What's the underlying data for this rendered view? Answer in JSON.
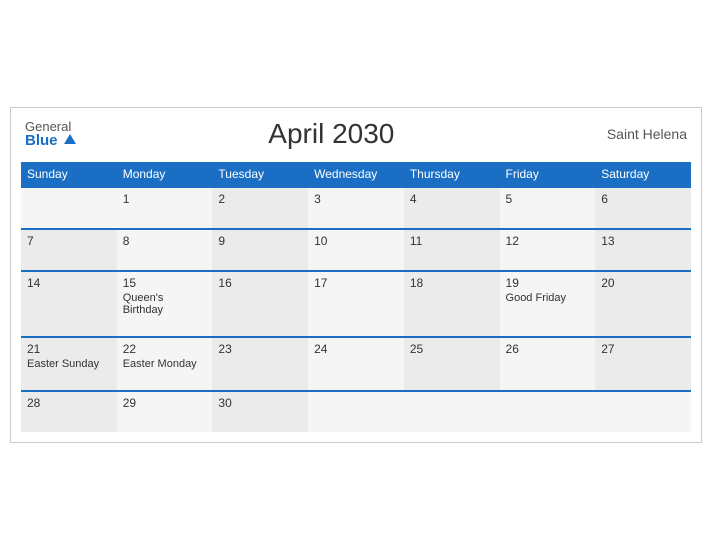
{
  "header": {
    "logo_general": "General",
    "logo_blue": "Blue",
    "title": "April 2030",
    "region": "Saint Helena"
  },
  "days_of_week": [
    "Sunday",
    "Monday",
    "Tuesday",
    "Wednesday",
    "Thursday",
    "Friday",
    "Saturday"
  ],
  "weeks": [
    [
      {
        "day": "",
        "event": ""
      },
      {
        "day": "1",
        "event": ""
      },
      {
        "day": "2",
        "event": ""
      },
      {
        "day": "3",
        "event": ""
      },
      {
        "day": "4",
        "event": ""
      },
      {
        "day": "5",
        "event": ""
      },
      {
        "day": "6",
        "event": ""
      }
    ],
    [
      {
        "day": "7",
        "event": ""
      },
      {
        "day": "8",
        "event": ""
      },
      {
        "day": "9",
        "event": ""
      },
      {
        "day": "10",
        "event": ""
      },
      {
        "day": "11",
        "event": ""
      },
      {
        "day": "12",
        "event": ""
      },
      {
        "day": "13",
        "event": ""
      }
    ],
    [
      {
        "day": "14",
        "event": ""
      },
      {
        "day": "15",
        "event": "Queen's Birthday"
      },
      {
        "day": "16",
        "event": ""
      },
      {
        "day": "17",
        "event": ""
      },
      {
        "day": "18",
        "event": ""
      },
      {
        "day": "19",
        "event": "Good Friday"
      },
      {
        "day": "20",
        "event": ""
      }
    ],
    [
      {
        "day": "21",
        "event": "Easter Sunday"
      },
      {
        "day": "22",
        "event": "Easter Monday"
      },
      {
        "day": "23",
        "event": ""
      },
      {
        "day": "24",
        "event": ""
      },
      {
        "day": "25",
        "event": ""
      },
      {
        "day": "26",
        "event": ""
      },
      {
        "day": "27",
        "event": ""
      }
    ],
    [
      {
        "day": "28",
        "event": ""
      },
      {
        "day": "29",
        "event": ""
      },
      {
        "day": "30",
        "event": ""
      },
      {
        "day": "",
        "event": ""
      },
      {
        "day": "",
        "event": ""
      },
      {
        "day": "",
        "event": ""
      },
      {
        "day": "",
        "event": ""
      }
    ]
  ]
}
